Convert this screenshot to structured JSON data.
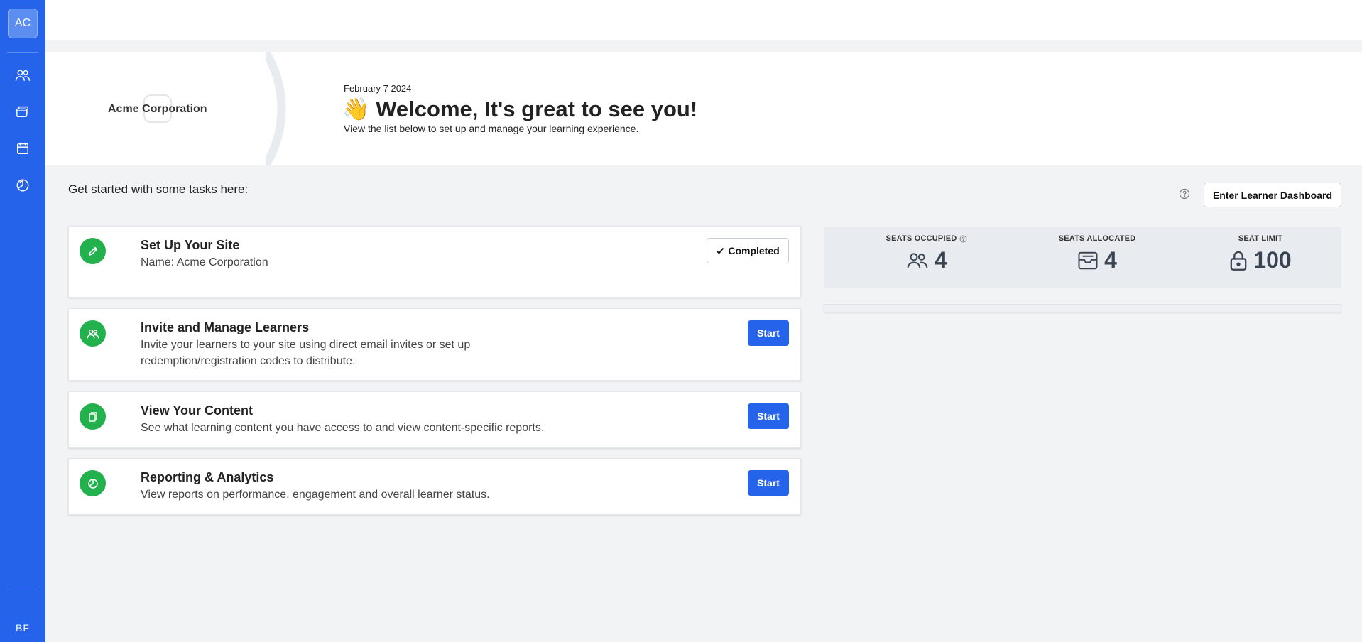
{
  "sidebar": {
    "org_initials": "AC",
    "user_initials": "BF",
    "nav": [
      {
        "icon": "users-icon"
      },
      {
        "icon": "content-icon"
      },
      {
        "icon": "calendar-icon"
      },
      {
        "icon": "analytics-icon"
      }
    ]
  },
  "banner": {
    "org_name": "Acme Corporation",
    "date": "February 7 2024",
    "headline": "👋 Welcome, It's great to see you!",
    "subtext": "View the list below to set up and manage your learning experience."
  },
  "tasks_header": {
    "title": "Get started with some tasks here:",
    "learner_dashboard_label": "Enter Learner Dashboard"
  },
  "tasks": [
    {
      "title": "Set Up Your Site",
      "description": "Name: Acme Corporation",
      "action": "Completed",
      "icon": "pencil-icon"
    },
    {
      "title": "Invite and Manage Learners",
      "description": "Invite your learners to your site using direct email invites or set up redemption/registration codes to distribute.",
      "action": "Start",
      "icon": "users-icon"
    },
    {
      "title": "View Your Content",
      "description": "See what learning content you have access to and view content-specific reports.",
      "action": "Start",
      "icon": "content-icon"
    },
    {
      "title": "Reporting & Analytics",
      "description": "View reports on performance, engagement and overall learner status.",
      "action": "Start",
      "icon": "analytics-icon"
    }
  ],
  "seats": {
    "occupied_label": "SEATS OCCUPIED",
    "occupied_value": "4",
    "allocated_label": "SEATS ALLOCATED",
    "allocated_value": "4",
    "limit_label": "SEAT LIMIT",
    "limit_value": "100",
    "usage_fraction": 0.04
  },
  "colors": {
    "primary": "#2563eb",
    "success": "#22b14c",
    "background": "#f1f3f5"
  }
}
